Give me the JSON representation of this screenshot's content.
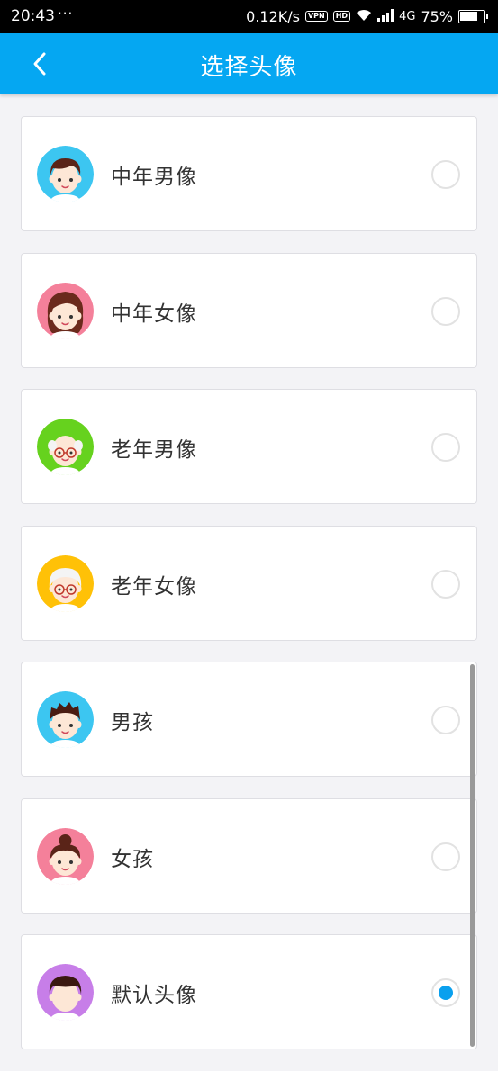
{
  "status_bar": {
    "time": "20:43",
    "dots": "···",
    "speed": "0.12K/s",
    "vpn": "VPN",
    "hd": "HD",
    "network": "4G",
    "battery": "75%",
    "battery_level": 0.75
  },
  "header": {
    "title": "选择头像",
    "back_icon": "chevron-left-icon"
  },
  "accent_color": "#05a7f2",
  "avatars": [
    {
      "label": "中年男像",
      "bg": "#3cc6f1",
      "kind": "middle-aged-man",
      "selected": false
    },
    {
      "label": "中年女像",
      "bg": "#f4809a",
      "kind": "middle-aged-woman",
      "selected": false
    },
    {
      "label": "老年男像",
      "bg": "#66d21e",
      "kind": "old-man",
      "selected": false
    },
    {
      "label": "老年女像",
      "bg": "#ffc107",
      "kind": "old-woman",
      "selected": false
    },
    {
      "label": "男孩",
      "bg": "#3cc6f1",
      "kind": "boy",
      "selected": false
    },
    {
      "label": "女孩",
      "bg": "#f4809a",
      "kind": "girl",
      "selected": false
    },
    {
      "label": "默认头像",
      "bg": "#c77ee8",
      "kind": "default",
      "selected": true
    }
  ]
}
